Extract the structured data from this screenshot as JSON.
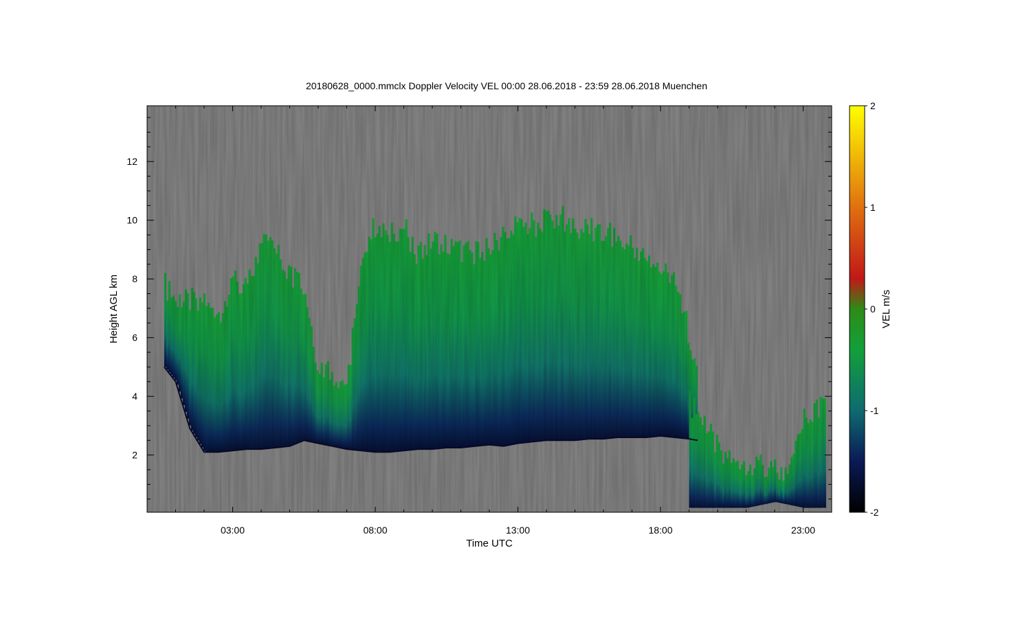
{
  "chart_data": {
    "type": "heatmap",
    "title": "20180628_0000.mmclx Doppler Velocity VEL   00:00 28.06.2018 - 23:59 28.06.2018 Muenchen",
    "xlabel": "Time UTC",
    "ylabel": "Height AGL km",
    "x_unit": "hours UTC",
    "xlim": [
      0.0,
      24.0
    ],
    "ylim": [
      0.05,
      13.9
    ],
    "x_ticks": [
      {
        "value": 3,
        "label": "03:00"
      },
      {
        "value": 8,
        "label": "08:00"
      },
      {
        "value": 13,
        "label": "13:00"
      },
      {
        "value": 18,
        "label": "18:00"
      },
      {
        "value": 23,
        "label": "23:00"
      }
    ],
    "y_ticks": [
      {
        "value": 2,
        "label": "2"
      },
      {
        "value": 4,
        "label": "4"
      },
      {
        "value": 6,
        "label": "6"
      },
      {
        "value": 8,
        "label": "8"
      },
      {
        "value": 10,
        "label": "10"
      },
      {
        "value": 12,
        "label": "12"
      }
    ],
    "colorbar": {
      "label": "VEL m/s",
      "range": [
        -2,
        2
      ],
      "ticks": [
        {
          "value": 2,
          "label": "2"
        },
        {
          "value": 1,
          "label": "1"
        },
        {
          "value": 0,
          "label": "0"
        },
        {
          "value": -1,
          "label": "-1"
        },
        {
          "value": -2,
          "label": "-2"
        }
      ],
      "stops": [
        {
          "value": -2,
          "color": "#000000"
        },
        {
          "value": -1.5,
          "color": "#0a1a55"
        },
        {
          "value": -1,
          "color": "#0f6a70"
        },
        {
          "value": -0.4,
          "color": "#12a03a"
        },
        {
          "value": 0,
          "color": "#2e8b16"
        },
        {
          "value": 0.3,
          "color": "#c01818"
        },
        {
          "value": 1,
          "color": "#e07010"
        },
        {
          "value": 2,
          "color": "#ffff00"
        }
      ]
    },
    "background_color": "#808080",
    "cloud_envelope": {
      "x": [
        0.6,
        1.0,
        1.5,
        2.0,
        2.5,
        3.0,
        3.5,
        4.0,
        4.5,
        5.0,
        5.5,
        6.0,
        6.5,
        7.0,
        7.5,
        8.0,
        8.5,
        9.0,
        9.5,
        10.0,
        10.5,
        11.0,
        11.5,
        12.0,
        12.5,
        13.0,
        13.5,
        14.0,
        14.5,
        15.0,
        15.5,
        16.0,
        16.5,
        17.0,
        17.5,
        18.0,
        18.5,
        19.0,
        19.3
      ],
      "top_km": [
        8.2,
        7.6,
        7.7,
        7.8,
        7.3,
        8.5,
        8.2,
        9.7,
        9.4,
        8.5,
        8.1,
        5.3,
        5.2,
        4.9,
        9.5,
        10.3,
        10.1,
        10.2,
        9.2,
        9.8,
        9.6,
        9.4,
        9.3,
        9.5,
        10.0,
        10.2,
        10.3,
        10.4,
        10.6,
        10.1,
        10.2,
        10.0,
        9.8,
        9.5,
        9.2,
        8.8,
        8.2,
        6.5,
        4.8
      ],
      "base_km": [
        5.0,
        4.5,
        2.9,
        2.1,
        2.1,
        2.15,
        2.2,
        2.2,
        2.25,
        2.3,
        2.5,
        2.4,
        2.3,
        2.2,
        2.15,
        2.1,
        2.1,
        2.15,
        2.2,
        2.2,
        2.25,
        2.25,
        2.3,
        2.35,
        2.3,
        2.4,
        2.45,
        2.5,
        2.5,
        2.5,
        2.55,
        2.55,
        2.6,
        2.6,
        2.6,
        2.65,
        2.6,
        2.55,
        2.5
      ]
    },
    "low_cloud_envelope": {
      "x": [
        19.0,
        19.5,
        20.0,
        20.5,
        21.0,
        21.5,
        22.0,
        22.5,
        23.0,
        23.5,
        23.8
      ],
      "top_km": [
        4.2,
        3.5,
        2.6,
        2.4,
        2.2,
        2.2,
        1.9,
        1.8,
        3.7,
        4.0,
        4.0
      ],
      "base_km": [
        0.2,
        0.2,
        0.2,
        0.2,
        0.2,
        0.3,
        0.4,
        0.3,
        0.2,
        0.2,
        0.2
      ]
    }
  }
}
